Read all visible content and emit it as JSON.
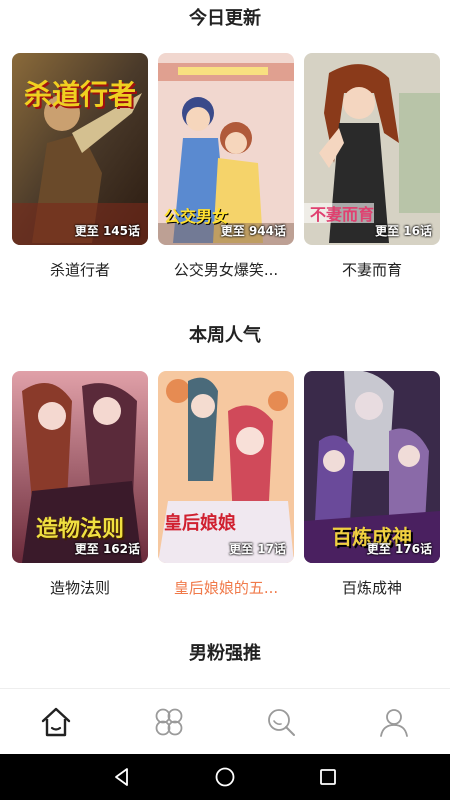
{
  "sections": [
    {
      "title": "今日更新",
      "items": [
        {
          "title": "杀道行者",
          "episode": "更至 145话",
          "cover_art_text": "杀道行者",
          "highlighted": false
        },
        {
          "title": "公交男女爆笑...",
          "episode": "更至 944话",
          "cover_art_text": "公交男女",
          "highlighted": false
        },
        {
          "title": "不妻而育",
          "episode": "更至 16话",
          "cover_art_text": "不妻而育",
          "highlighted": false
        }
      ]
    },
    {
      "title": "本周人气",
      "items": [
        {
          "title": "造物法则",
          "episode": "更至 162话",
          "cover_art_text": "造物法则",
          "highlighted": false
        },
        {
          "title": "皇后娘娘的五...",
          "episode": "更至 17话",
          "cover_art_text": "皇后娘娘",
          "highlighted": true
        },
        {
          "title": "百炼成神",
          "episode": "更至 176话",
          "cover_art_text": "百炼成神",
          "highlighted": false
        }
      ]
    },
    {
      "title": "男粉强推",
      "items": []
    }
  ],
  "tabbar": {
    "tabs": [
      {
        "icon": "home-icon",
        "selected": true
      },
      {
        "icon": "category-icon",
        "selected": false
      },
      {
        "icon": "search-icon",
        "selected": false
      },
      {
        "icon": "profile-icon",
        "selected": false
      }
    ]
  },
  "system_nav": {
    "buttons": [
      "back-icon",
      "home-circle-icon",
      "recents-icon"
    ]
  },
  "colors": {
    "highlight_title": "#f07a4a",
    "title_text": "#222222",
    "nav_bar": "#000000"
  }
}
